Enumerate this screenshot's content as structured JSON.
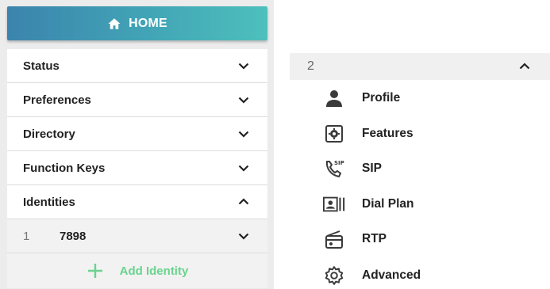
{
  "home": {
    "label": "HOME",
    "icon": "home-icon"
  },
  "nav": {
    "items": [
      {
        "label": "Status",
        "expanded": false
      },
      {
        "label": "Preferences",
        "expanded": false
      },
      {
        "label": "Directory",
        "expanded": false
      },
      {
        "label": "Function Keys",
        "expanded": false
      },
      {
        "label": "Identities",
        "expanded": true
      }
    ],
    "identity": {
      "index": "1",
      "extension": "7898",
      "expanded": false
    },
    "add_identity": "Add Identity"
  },
  "identity_detail": {
    "index": "2",
    "expanded": true,
    "items": [
      {
        "label": "Profile",
        "icon": "person-icon"
      },
      {
        "label": "Features",
        "icon": "features-gear-icon"
      },
      {
        "label": "SIP",
        "icon": "sip-phone-icon",
        "icon_text": "SIP"
      },
      {
        "label": "Dial Plan",
        "icon": "dial-plan-icon"
      },
      {
        "label": "RTP",
        "icon": "radio-icon"
      },
      {
        "label": "Advanced",
        "icon": "gear-icon"
      }
    ]
  },
  "colors": {
    "home_gradient_start": "#3b84ad",
    "home_gradient_end": "#4dc0bc",
    "add_identity": "#6ad38e"
  }
}
